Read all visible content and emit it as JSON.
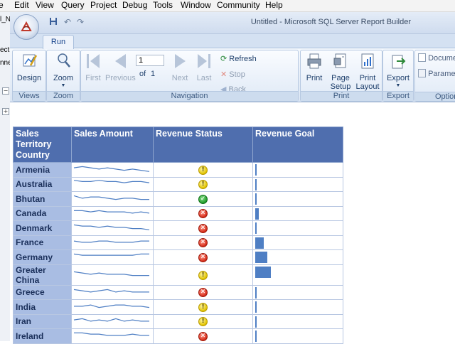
{
  "ide_menu": [
    "e",
    "Edit",
    "View",
    "Query",
    "Project",
    "Debug",
    "Tools",
    "Window",
    "Community",
    "Help"
  ],
  "ide_left": {
    "frag1": "l_N",
    "frag2": "ect",
    "frag3": "nne"
  },
  "window": {
    "title": "Untitled - Microsoft SQL Server Report Builder"
  },
  "ribbon": {
    "tab": "Run",
    "views": {
      "label": "Views",
      "design": "Design"
    },
    "zoom": {
      "label": "Zoom",
      "zoom": "Zoom"
    },
    "navigation": {
      "label": "Navigation",
      "first": "First",
      "previous": "Previous",
      "next": "Next",
      "last": "Last",
      "page_value": "1",
      "of_text": "of",
      "total_pages": "1",
      "refresh": "Refresh",
      "stop": "Stop",
      "back": "Back"
    },
    "print": {
      "label": "Print",
      "print": "Print",
      "page_setup_1": "Page",
      "page_setup_2": "Setup",
      "print_layout_1": "Print",
      "print_layout_2": "Layout"
    },
    "export": {
      "label": "Export",
      "export": "Export"
    },
    "options": {
      "label": "Option",
      "document": "Docume",
      "parameters": "Paramet"
    }
  },
  "report": {
    "headers": {
      "country": "Sales Territory Country",
      "amount": "Sales Amount",
      "status": "Revenue Status",
      "goal": "Revenue Goal"
    },
    "rows": [
      {
        "country": "Armenia",
        "status": "warn",
        "goal": 0.02,
        "spark": [
          4,
          5,
          4,
          3,
          4,
          3,
          2,
          3,
          2,
          1
        ]
      },
      {
        "country": "Australia",
        "status": "warn",
        "goal": 0.02,
        "spark": [
          6,
          5,
          5,
          6,
          5,
          5,
          4,
          5,
          5,
          4
        ]
      },
      {
        "country": "Bhutan",
        "status": "ok",
        "goal": 0.02,
        "spark": [
          5,
          3,
          4,
          4,
          3,
          2,
          3,
          3,
          2,
          2
        ]
      },
      {
        "country": "Canada",
        "status": "bad",
        "goal": 0.04,
        "spark": [
          5,
          5,
          4,
          5,
          4,
          4,
          4,
          3,
          4,
          3
        ]
      },
      {
        "country": "Denmark",
        "status": "bad",
        "goal": 0.02,
        "spark": [
          5,
          4,
          4,
          3,
          4,
          3,
          3,
          2,
          2,
          1
        ]
      },
      {
        "country": "France",
        "status": "bad",
        "goal": 0.1,
        "spark": [
          4,
          3,
          3,
          4,
          4,
          3,
          3,
          3,
          4,
          4
        ]
      },
      {
        "country": "Germany",
        "status": "bad",
        "goal": 0.14,
        "spark": [
          5,
          4,
          4,
          4,
          4,
          4,
          4,
          4,
          5,
          5
        ]
      },
      {
        "country": "Greater China",
        "status": "warn",
        "goal": 0.18,
        "spark": [
          5,
          4,
          3,
          4,
          3,
          3,
          3,
          2,
          2,
          2
        ]
      },
      {
        "country": "Greece",
        "status": "bad",
        "goal": 0.02,
        "spark": [
          5,
          4,
          3,
          4,
          5,
          3,
          4,
          3,
          3,
          3
        ]
      },
      {
        "country": "India",
        "status": "warn",
        "goal": 0.02,
        "spark": [
          3,
          3,
          4,
          2,
          3,
          4,
          4,
          3,
          3,
          2
        ]
      },
      {
        "country": "Iran",
        "status": "warn",
        "goal": 0.02,
        "spark": [
          4,
          5,
          3,
          4,
          3,
          5,
          3,
          4,
          3,
          3
        ]
      },
      {
        "country": "Ireland",
        "status": "bad",
        "goal": 0.02,
        "spark": [
          5,
          5,
          4,
          4,
          3,
          3,
          3,
          4,
          3,
          3
        ]
      }
    ]
  },
  "status_glyphs": {
    "warn": "!",
    "ok": "✓",
    "bad": "✕"
  },
  "colors": {
    "header_bg": "#4f6eae",
    "country_bg": "#a9bde3",
    "bar": "#4f7fc4",
    "sparkline": "#4f7fc4"
  }
}
